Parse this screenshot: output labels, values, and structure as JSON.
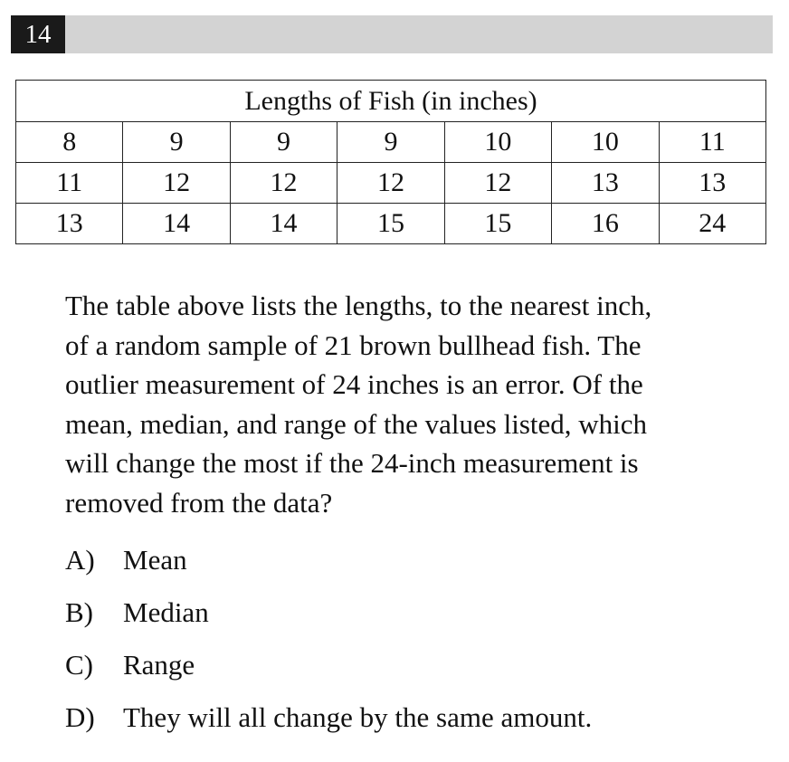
{
  "question": {
    "number": "14"
  },
  "table": {
    "title": "Lengths of Fish (in inches)",
    "rows": [
      [
        "8",
        "9",
        "9",
        "9",
        "10",
        "10",
        "11"
      ],
      [
        "11",
        "12",
        "12",
        "12",
        "12",
        "13",
        "13"
      ],
      [
        "13",
        "14",
        "14",
        "15",
        "15",
        "16",
        "24"
      ]
    ]
  },
  "passage": {
    "lines": [
      "The table above lists the lengths, to the nearest inch,",
      "of a random sample of 21 brown bullhead fish.  The",
      "outlier measurement of 24 inches is an error.  Of the",
      "mean, median, and range of the values listed, which",
      "will change the most if the 24-inch measurement is",
      "removed from the data?"
    ]
  },
  "choices": [
    {
      "letter": "A)",
      "text": "Mean"
    },
    {
      "letter": "B)",
      "text": "Median"
    },
    {
      "letter": "C)",
      "text": "Range"
    },
    {
      "letter": "D)",
      "text": "They will all change by the same amount."
    }
  ]
}
